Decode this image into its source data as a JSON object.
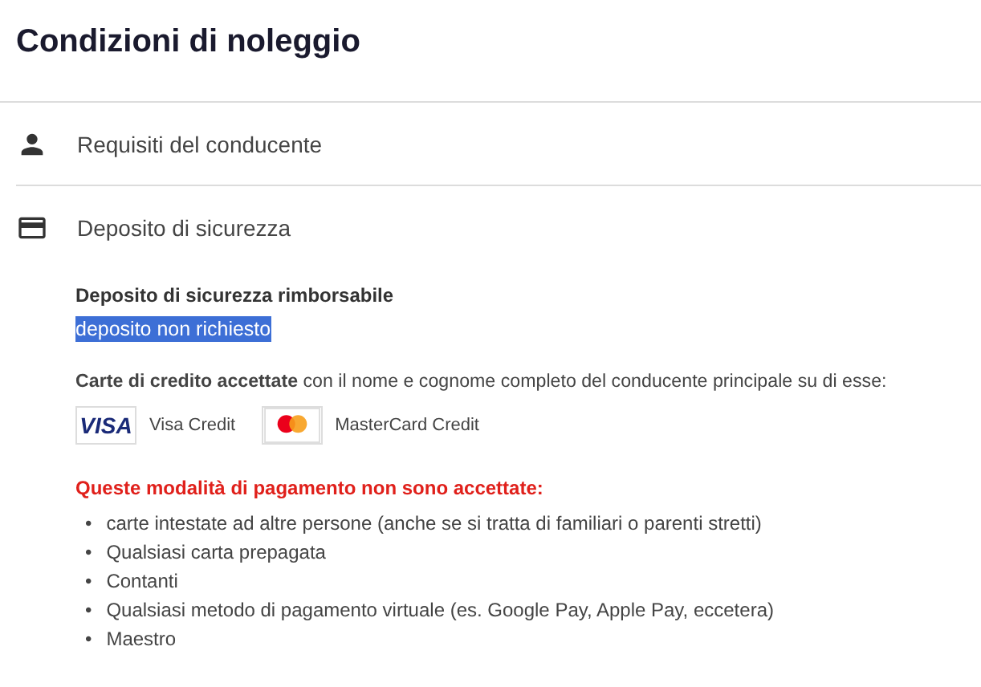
{
  "title": "Condizioni di noleggio",
  "sections": [
    {
      "kind": "person",
      "label": "Requisiti del conducente"
    },
    {
      "kind": "card",
      "label": "Deposito di sicurezza"
    }
  ],
  "deposit": {
    "heading": "Deposito di sicurezza rimborsabile",
    "value": "deposito non richiesto",
    "highlighted": true
  },
  "cards_note": "**Carte di credito accettate** con il nome e cognome completo del conducente principale su di esse:",
  "cards": [
    {
      "kind": "visa",
      "logo_text": "VISA",
      "label": "Visa Credit"
    },
    {
      "kind": "mastercard",
      "label": "MasterCard Credit"
    }
  ],
  "not_accepted": {
    "heading": "Queste modalità di pagamento non sono accettate:",
    "marker": "•",
    "items": [
      "carte intestate ad altre persone (anche se si tratta di familiari o parenti stretti)",
      "Qualsiasi carta prepagata",
      "Contanti",
      "Qualsiasi metodo di pagamento virtuale (es. Google Pay, Apple Pay, eccetera)",
      "Maestro"
    ]
  }
}
